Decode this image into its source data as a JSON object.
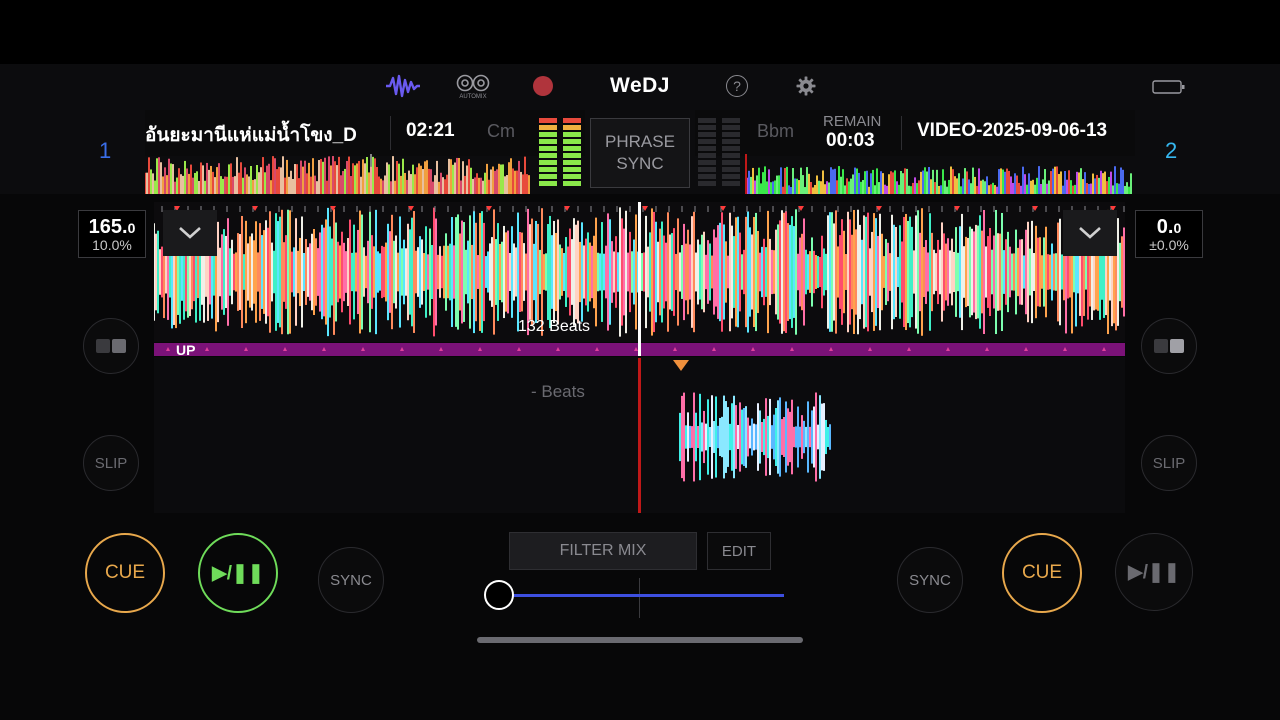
{
  "app": {
    "brand": "WeDJ"
  },
  "top_icons": {
    "waveform": "waveform-icon",
    "automix_label": "AUTOMIX",
    "record": "record-icon",
    "help": "?",
    "settings": "gear-icon",
    "battery": "battery-icon"
  },
  "deck1": {
    "number": "1",
    "title": "อันยะมานีแห่แม่น้ำโขง_D",
    "time": "02:21",
    "key": "Cm",
    "bpm": "165.",
    "bpm_decimal": "0",
    "tempo": "10.0%",
    "slip": "SLIP",
    "cue": "CUE",
    "play": "▶/❚❚",
    "sync": "SYNC",
    "beats_label": "132 Beats",
    "phrase_label": "UP"
  },
  "deck2": {
    "number": "2",
    "title": "VIDEO-2025-09-06-13",
    "remain_label": "REMAIN",
    "remain": "00:03",
    "key": "Bbm",
    "bpm": "0.",
    "bpm_decimal": "0",
    "tempo": "±0.0%",
    "slip": "SLIP",
    "cue": "CUE",
    "play": "▶/❚❚",
    "sync": "SYNC",
    "beats_label": "- Beats"
  },
  "center": {
    "phrase_sync_line1": "PHRASE",
    "phrase_sync_line2": "SYNC",
    "filter_mix": "FILTER MIX",
    "edit": "EDIT",
    "crossfader_position": 0
  },
  "colors": {
    "deck1_number": "#3a6ee8",
    "deck2_number": "#36b8f0",
    "cue_ring": "#e8a84c",
    "play_ring": "#6fdc5a",
    "purple_band": "#7b1278",
    "fader_line": "#3d4fe0"
  }
}
